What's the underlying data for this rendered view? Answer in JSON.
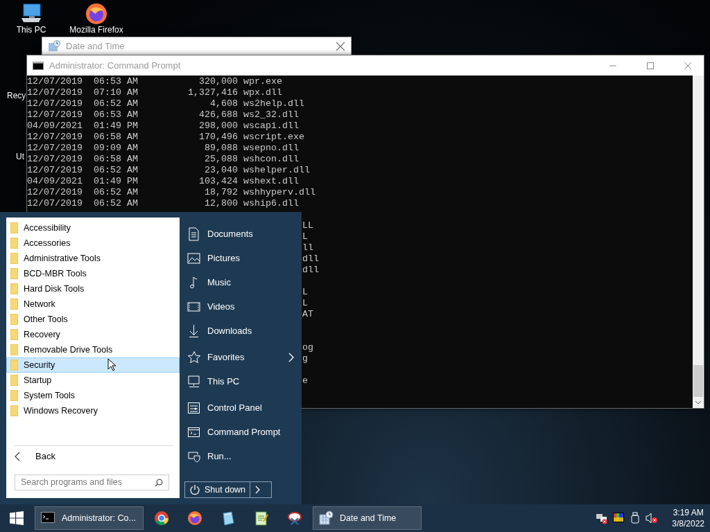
{
  "desktop_icons": [
    {
      "label": "This PC",
      "kind": "pc"
    },
    {
      "label": "Mozilla Firefox",
      "kind": "firefox"
    },
    {
      "label": "Recy",
      "kind": "partial"
    },
    {
      "label": "Ut",
      "kind": "partial"
    }
  ],
  "date_time_window": {
    "title": "Date and Time"
  },
  "cmd_window": {
    "title": "Administrator: Command Prompt",
    "lines": [
      "12/07/2019  06:53 AM           320,000 wpr.exe",
      "12/07/2019  07:10 AM         1,327,416 wpx.dll",
      "12/07/2019  06:52 AM             4,608 ws2help.dll",
      "12/07/2019  06:53 AM           426,688 ws2_32.dll",
      "04/09/2021  01:49 PM           298,000 wscapi.dll",
      "12/07/2019  06:58 AM           170,496 wscript.exe",
      "12/07/2019  09:09 AM            89,088 wsepno.dll",
      "12/07/2019  06:58 AM            25,088 wshcon.dll",
      "12/07/2019  06:52 AM            23,040 wshelper.dll",
      "04/09/2021  01:49 PM           103,424 wshext.dll",
      "12/07/2019  06:52 AM            18,792 wshhyperv.dll",
      "12/07/2019  06:52 AM            12,800 wship6.dll"
    ],
    "covered_lines": [
      {
        "kind": "blank"
      },
      {
        "kind": "text",
        "text": "LL"
      },
      {
        "kind": "text",
        "text": "L"
      },
      {
        "kind": "text",
        "text": "ll"
      },
      {
        "kind": "text",
        "text": "dll"
      },
      {
        "kind": "text",
        "text": "dll"
      },
      {
        "kind": "blank"
      },
      {
        "kind": "text",
        "text": "L"
      },
      {
        "kind": "text",
        "text": "L"
      },
      {
        "kind": "text",
        "text": "AT"
      },
      {
        "kind": "blank"
      },
      {
        "kind": "blank"
      },
      {
        "kind": "text",
        "text": "og"
      },
      {
        "kind": "text",
        "text": "g"
      },
      {
        "kind": "blank"
      },
      {
        "kind": "text",
        "text": "e"
      }
    ]
  },
  "start_menu": {
    "programs": [
      {
        "label": "Accessibility",
        "selected": false
      },
      {
        "label": "Accessories",
        "selected": false
      },
      {
        "label": "Administrative Tools",
        "selected": false
      },
      {
        "label": "BCD-MBR Tools",
        "selected": false
      },
      {
        "label": "Hard Disk Tools",
        "selected": false
      },
      {
        "label": "Network",
        "selected": false
      },
      {
        "label": "Other Tools",
        "selected": false
      },
      {
        "label": "Recovery",
        "selected": false
      },
      {
        "label": "Removable Drive Tools",
        "selected": false
      },
      {
        "label": "Security",
        "selected": true
      },
      {
        "label": "Startup",
        "selected": false
      },
      {
        "label": "System Tools",
        "selected": false
      },
      {
        "label": "Windows Recovery",
        "selected": false
      }
    ],
    "back": "Back",
    "search": {
      "placeholder": "Search programs and files"
    },
    "places": [
      {
        "label": "Documents",
        "kind": "documents",
        "submenu": false
      },
      {
        "label": "Pictures",
        "kind": "pictures",
        "submenu": false
      },
      {
        "label": "Music",
        "kind": "music",
        "submenu": false
      },
      {
        "label": "Videos",
        "kind": "videos",
        "submenu": false
      },
      {
        "label": "Downloads",
        "kind": "downloads",
        "submenu": false
      },
      {
        "label": "Favorites",
        "kind": "favorites",
        "submenu": true
      },
      {
        "label": "This PC",
        "kind": "pc",
        "submenu": false
      },
      {
        "label": "Control Panel",
        "kind": "control",
        "submenu": false
      },
      {
        "label": "Command Prompt",
        "kind": "cmd",
        "submenu": false
      },
      {
        "label": "Run...",
        "kind": "run",
        "submenu": false
      }
    ],
    "shutdown": "Shut down"
  },
  "taskbar": {
    "items": [
      {
        "kind": "console",
        "label": "Administrator: Co..."
      },
      {
        "kind": "chrome"
      },
      {
        "kind": "firefox"
      },
      {
        "kind": "crystal"
      },
      {
        "kind": "notepad"
      },
      {
        "kind": "scissors"
      },
      {
        "kind": "calendar",
        "label": "Date and Time"
      }
    ],
    "time": "3:19 AM",
    "date": "3/8/2022"
  }
}
